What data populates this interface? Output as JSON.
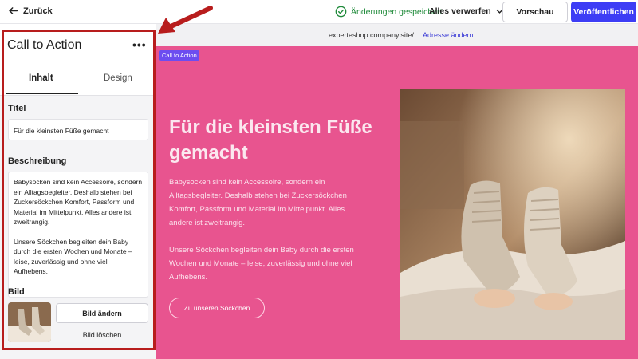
{
  "topbar": {
    "back_label": "Zurück",
    "saved_status": "Änderungen gespeichert",
    "discard_label": "Alles verwerfen",
    "preview_label": "Vorschau",
    "publish_label": "Veröffentlichen",
    "accent_color": "#3d3df5",
    "saved_color": "#1f8a3a"
  },
  "panel": {
    "title": "Call to Action",
    "more_icon": "more-horizontal-icon",
    "tabs": [
      {
        "label": "Inhalt",
        "active": true
      },
      {
        "label": "Design",
        "active": false
      }
    ],
    "title_label": "Titel",
    "title_value": "Für die kleinsten Füße gemacht",
    "description_label": "Beschreibung",
    "description_p1": "Babysocken sind kein Accessoire, sondern ein Alltagsbegleiter. Deshalb stehen bei Zuckersöckchen Komfort, Passform und Material im Mittelpunkt. Alles andere ist zweitrangig.",
    "description_p2": "Unsere Söckchen begleiten dein Baby durch die ersten Wochen und Monate – leise, zuverlässig und ohne viel Aufhebens.",
    "image_label": "Bild",
    "change_image_label": "Bild ändern",
    "delete_image_label": "Bild löschen"
  },
  "urlbar": {
    "url": "experteshop.company.site/",
    "change_address_label": "Adresse ändern"
  },
  "preview": {
    "block_tag": "Call to Action",
    "hero_title": "Für die kleinsten Füße gemacht",
    "hero_desc_p1": "Babysocken sind kein Accessoire, sondern ein Alltagsbegleiter. Deshalb stehen bei Zuckersöckchen Komfort, Passform und Material im Mittelpunkt. Alles andere ist zweitrangig.",
    "hero_desc_p2": "Unsere Söckchen begleiten dein Baby durch die ersten Wochen und Monate – leise, zuverlässig und ohne viel Aufhebens.",
    "cta_button": "Zu unseren Söckchen",
    "background_color": "#e8548f"
  },
  "annotation": {
    "color": "#b81d1d"
  }
}
